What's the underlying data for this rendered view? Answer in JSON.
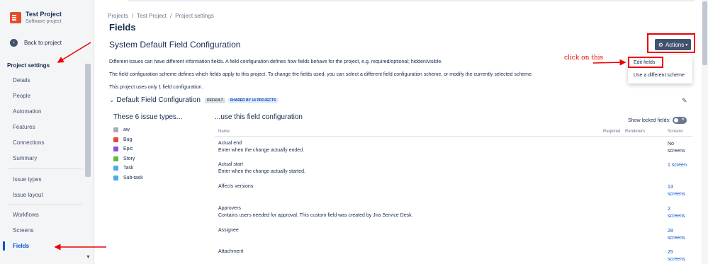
{
  "project": {
    "name": "Test Project",
    "type": "Software project"
  },
  "sidebar": {
    "back_label": "Back to project",
    "section_title": "Project settings",
    "items": [
      {
        "label": "Details"
      },
      {
        "label": "People"
      },
      {
        "label": "Automation"
      },
      {
        "label": "Features"
      },
      {
        "label": "Connections"
      },
      {
        "label": "Summary"
      },
      {
        "label": "Issue types"
      },
      {
        "label": "Issue layout"
      },
      {
        "label": "Workflows"
      },
      {
        "label": "Screens"
      },
      {
        "label": "Fields"
      }
    ]
  },
  "breadcrumb": [
    "Projects",
    "/",
    "Test Project",
    "/",
    "Project settings"
  ],
  "page_title": "Fields",
  "config_title": "System Default Field Configuration",
  "actions_label": "Actions",
  "dropdown": {
    "items": [
      "Edit fields",
      "Use a different scheme"
    ]
  },
  "annotation": "click on this",
  "descriptions": [
    "Different issues can have different information fields. A field configuration defines how fields behave for the project, e.g. required/optional; hidden/visible.",
    "The field configuration scheme defines which fields apply to this project. To change the fields used, you can select a different field configuration scheme, or modify the currently selected scheme.",
    "This project uses only 1 field configuration."
  ],
  "section": {
    "name": "Default Field Configuration",
    "badge_default": "DEFAULT",
    "badge_shared": "SHARED BY 14 PROJECTS"
  },
  "issue_types_heading": "These 6 issue types...",
  "issue_types": [
    {
      "name": "aw",
      "color": "#a5adba"
    },
    {
      "name": "Bug",
      "color": "#e5493a"
    },
    {
      "name": "Epic",
      "color": "#904ee2"
    },
    {
      "name": "Story",
      "color": "#63ba3c"
    },
    {
      "name": "Task",
      "color": "#4bade8"
    },
    {
      "name": "Sub-task",
      "color": "#4bade8"
    }
  ],
  "field_config_heading": "...use this field configuration",
  "show_locked_label": "Show locked fields:",
  "columns": {
    "name": "Name",
    "required": "Required",
    "renderers": "Renderers",
    "screens": "Screens"
  },
  "fields": [
    {
      "name": "Actual end",
      "desc": "Enter when the change actually ended.",
      "screens_1": "No",
      "screens_2": "screens"
    },
    {
      "name": "Actual start",
      "desc": "Enter when the change actually started.",
      "screens_1": "1 screen",
      "screens_2": ""
    },
    {
      "name": "Affects versions",
      "desc": "",
      "screens_1": "13",
      "screens_2": "screens"
    },
    {
      "name": "Approvers",
      "desc": "Contains users needed for approval. This custom field was created by Jira Service Desk.",
      "screens_1": "2",
      "screens_2": "screens"
    },
    {
      "name": "Assignee",
      "desc": "",
      "screens_1": "28",
      "screens_2": "screens"
    },
    {
      "name": "Attachment",
      "desc": "",
      "screens_1": "25",
      "screens_2": "screens"
    }
  ]
}
